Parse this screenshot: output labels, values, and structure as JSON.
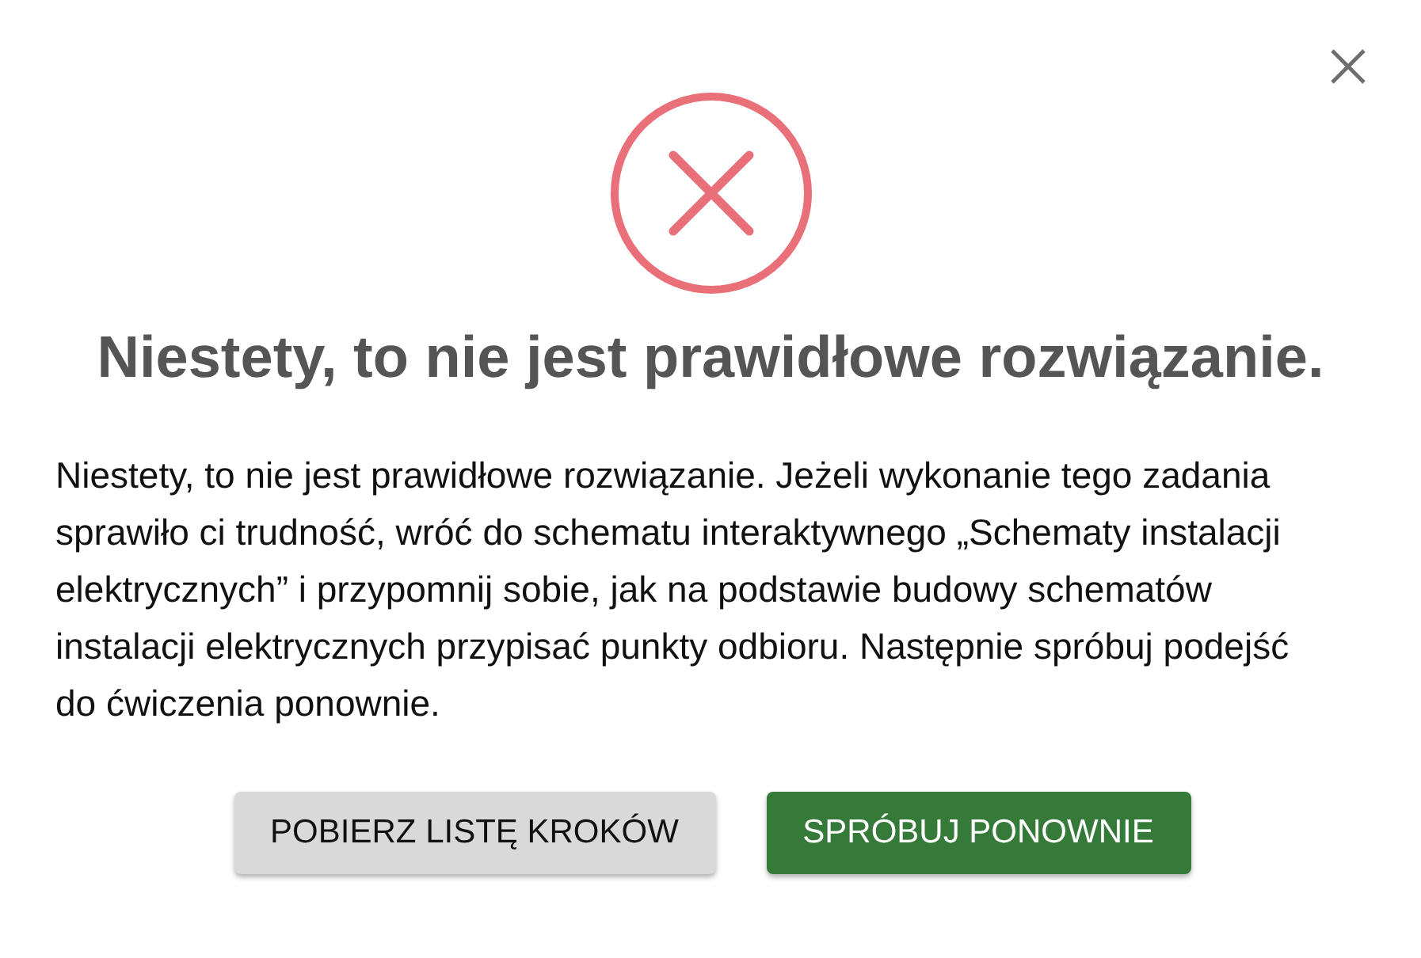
{
  "dialog": {
    "title": "Niestety, to nie jest prawidłowe rozwiązanie.",
    "message": "Niestety, to nie jest prawidłowe rozwiązanie. Jeżeli wykonanie tego zadania sprawiło ci trudność, wróć do schematu interaktywnego „Schematy instalacji elektrycznych” i przypomnij sobie, jak na podstawie budowy schematów instalacji elektrycznych przypisać punkty odbioru. Następnie spróbuj podejść do ćwiczenia ponownie.",
    "buttons": [
      {
        "label": "POBIERZ LISTĘ KROKÓW",
        "kind": "secondary"
      },
      {
        "label": "SPRÓBUJ PONOWNIE",
        "kind": "primary"
      }
    ]
  }
}
